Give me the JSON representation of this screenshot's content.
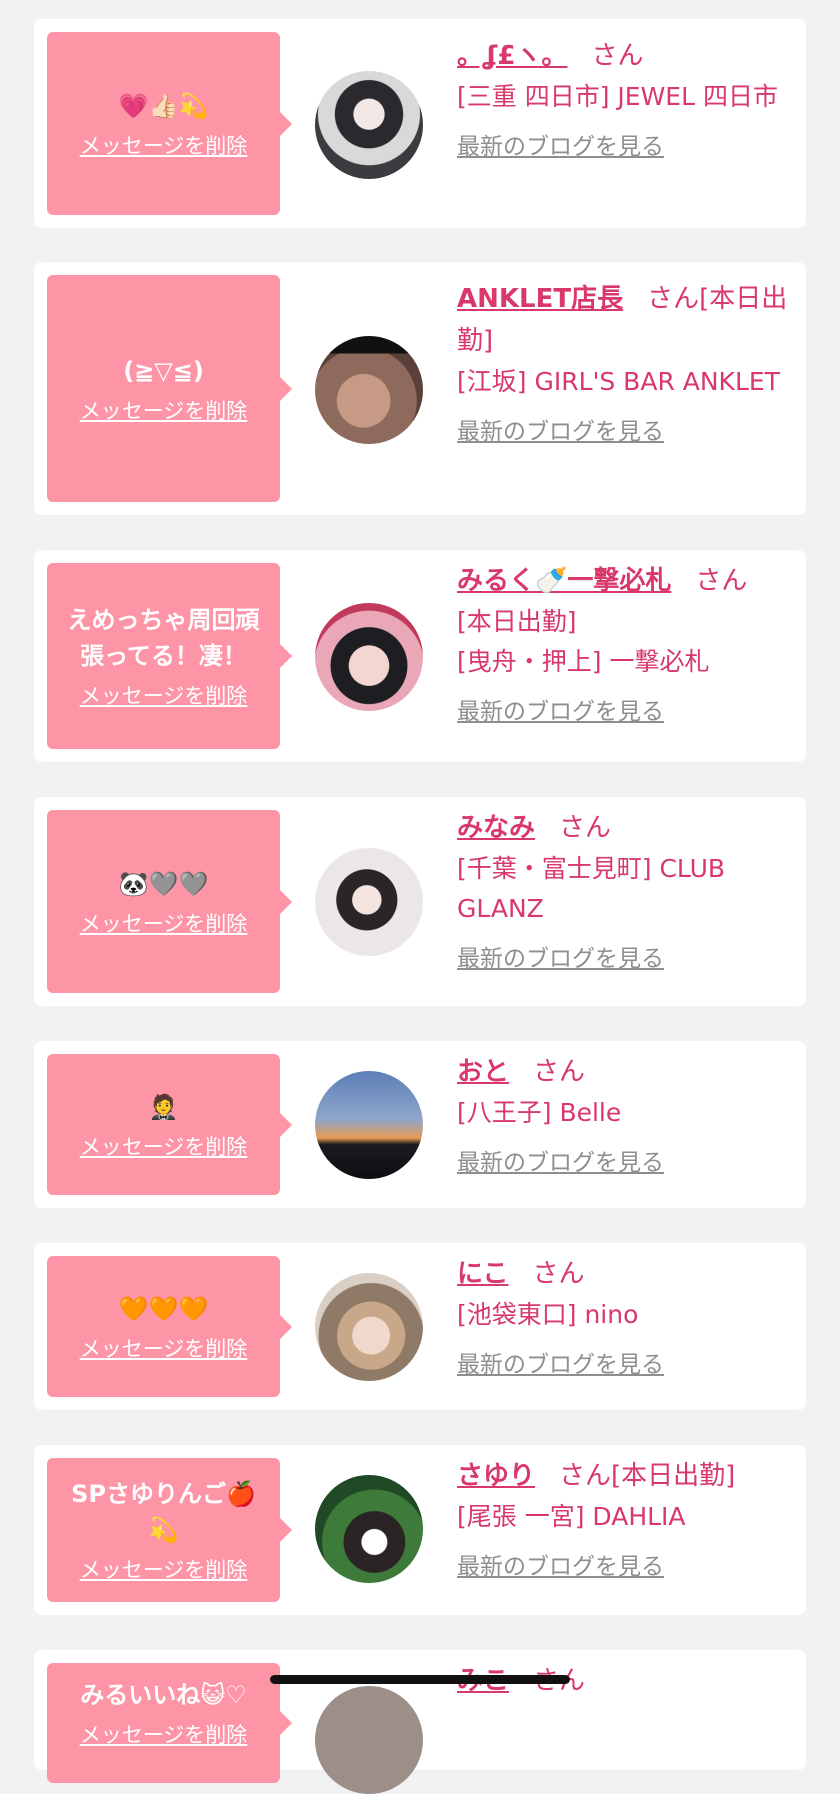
{
  "cards": [
    {
      "message": "💗👍🏻💫",
      "delete_label": "メッセージを削除",
      "name": "。ʆ£ヽ。",
      "san": "さん",
      "badge": "",
      "shop": "[三重 四日市] JEWEL 四日市",
      "blog_label": "最新のブログを見る"
    },
    {
      "message": "(≧▽≦)",
      "delete_label": "メッセージを削除",
      "name": "ANKLET店長",
      "san": "さん",
      "badge": "[本日出勤]",
      "shop": "[江坂] GIRL'S BAR ANKLET",
      "blog_label": "最新のブログを見る"
    },
    {
      "message": "えめっちゃ周回頑張ってる！凄！",
      "delete_label": "メッセージを削除",
      "name": "みるく🍼一撃必札",
      "san": "さん",
      "badge": "[本日出勤]",
      "shop": "[曳舟・押上] 一撃必札",
      "blog_label": "最新のブログを見る"
    },
    {
      "message": "🐼🩶🩶",
      "delete_label": "メッセージを削除",
      "name": "みなみ",
      "san": "さん",
      "badge": "",
      "shop": "[千葉・富士見町] CLUB GLANZ",
      "blog_label": "最新のブログを見る"
    },
    {
      "message": "🤵",
      "delete_label": "メッセージを削除",
      "name": "おと",
      "san": "さん",
      "badge": "",
      "shop": "[八王子] Belle",
      "blog_label": "最新のブログを見る"
    },
    {
      "message": "🧡🧡🧡",
      "delete_label": "メッセージを削除",
      "name": "にこ",
      "san": "さん",
      "badge": "",
      "shop": "[池袋東口] nino",
      "blog_label": "最新のブログを見る"
    },
    {
      "message": "SPさゆりんご🍎💫",
      "delete_label": "メッセージを削除",
      "name": "さゆり",
      "san": "さん",
      "badge": "[本日出勤]",
      "shop": "[尾張 一宮] DAHLIA",
      "blog_label": "最新のブログを見る"
    },
    {
      "message": "みるいいね😺♡",
      "delete_label": "メッセージを削除",
      "name": "みこ",
      "san": "さん",
      "badge": "",
      "shop": "",
      "blog_label": ""
    }
  ]
}
